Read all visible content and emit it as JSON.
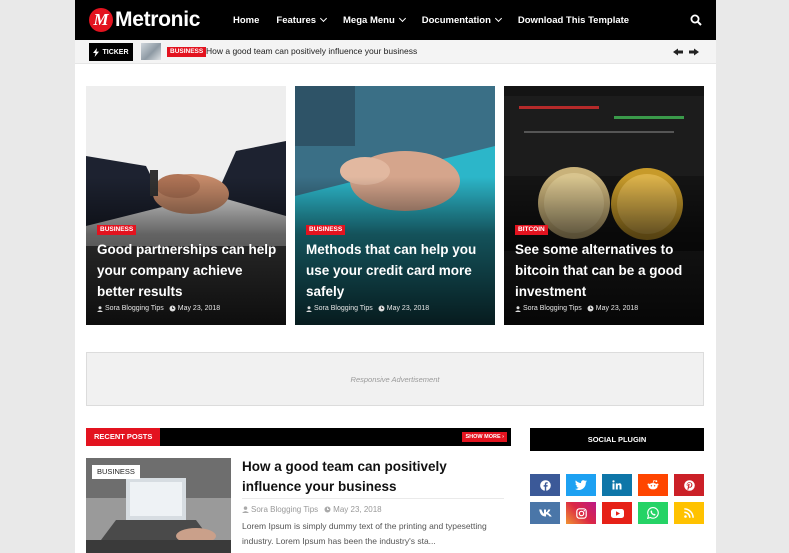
{
  "header": {
    "logo_letter": "M",
    "logo_text": "Metronic",
    "nav": [
      {
        "label": "Home",
        "dropdown": false
      },
      {
        "label": "Features",
        "dropdown": true
      },
      {
        "label": "Mega Menu",
        "dropdown": true
      },
      {
        "label": "Documentation",
        "dropdown": true
      },
      {
        "label": "Download This Template",
        "dropdown": false
      }
    ],
    "search_icon": "search-icon"
  },
  "ticker": {
    "label": "TICKER",
    "category": "BUSINESS",
    "headline": "How a good team can positively influence your business"
  },
  "featured": [
    {
      "category": "BUSINESS",
      "title": "Good partnerships can help your company achieve better results",
      "author": "Sora Blogging Tips",
      "date": "May 23, 2018"
    },
    {
      "category": "BUSINESS",
      "title": "Methods that can help you use your credit card more safely",
      "author": "Sora Blogging Tips",
      "date": "May 23, 2018"
    },
    {
      "category": "BITCOIN",
      "title": "See some alternatives to bitcoin that can be a good investment",
      "author": "Sora Blogging Tips",
      "date": "May 23, 2018"
    }
  ],
  "ad": {
    "text": "Responsive Advertisement"
  },
  "recent": {
    "heading": "RECENT POSTS",
    "show_more": "SHOW MORE",
    "post": {
      "category": "BUSINESS",
      "title": "How a good team can positively influence your business",
      "author": "Sora Blogging Tips",
      "date": "May 23, 2018",
      "snippet": "Lorem Ipsum is simply dummy text of the printing and typesetting industry. Lorem Ipsum has been the industry's sta..."
    }
  },
  "social": {
    "heading": "SOCIAL PLUGIN",
    "buttons": [
      {
        "icon": "facebook-icon",
        "color": "#3b5998"
      },
      {
        "icon": "twitter-icon",
        "color": "#1da1f2"
      },
      {
        "icon": "linkedin-icon",
        "color": "#0e76a8"
      },
      {
        "icon": "reddit-icon",
        "color": "#ff4500"
      },
      {
        "icon": "pinterest-icon",
        "color": "#cb2027"
      },
      {
        "icon": "vk-icon",
        "color": "#4a76a8"
      },
      {
        "icon": "instagram-icon",
        "color": "#c13584"
      },
      {
        "icon": "youtube-icon",
        "color": "#e62117"
      },
      {
        "icon": "whatsapp-icon",
        "color": "#25d366"
      },
      {
        "icon": "rss-icon",
        "color": "#ffc200"
      }
    ]
  },
  "colors": {
    "accent": "#e3131f",
    "dark": "#000000"
  }
}
